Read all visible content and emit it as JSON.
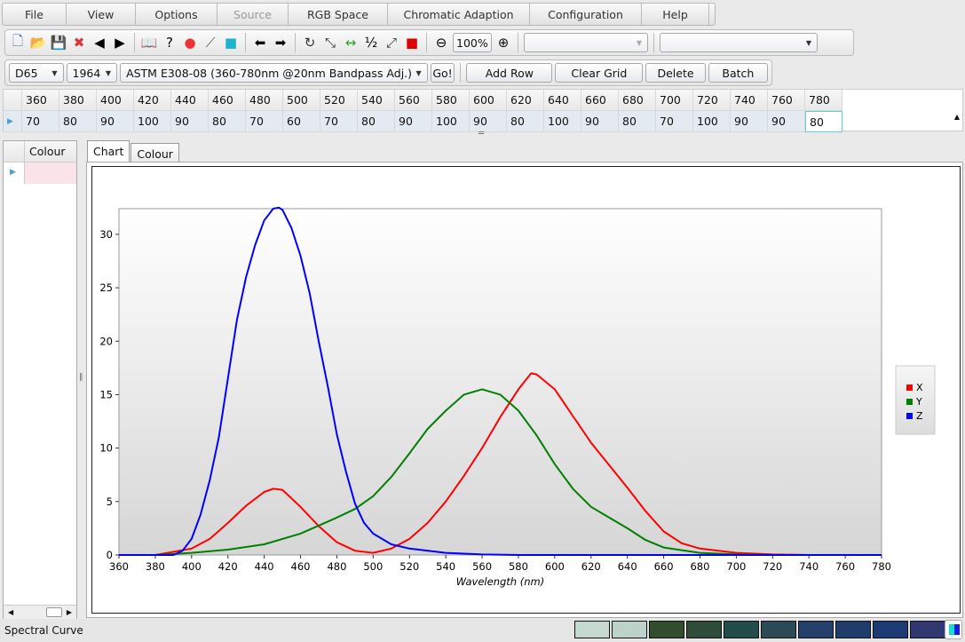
{
  "menu": [
    "File",
    "View",
    "Options",
    "Source",
    "RGB Space",
    "Chromatic Adaption",
    "Configuration",
    "Help"
  ],
  "toolbar": {
    "zoom": "100%",
    "icons": [
      "new-file-icon",
      "open-folder-icon",
      "save-icon",
      "close-file-icon",
      "import-icon",
      "export-icon",
      "book-icon",
      "help-icon",
      "color-wheel-icon",
      "chart-icon",
      "color-squares-icon",
      "back-arrow-icon",
      "forward-arrow-icon",
      "rotate-icon",
      "size-icon",
      "fit-width-icon",
      "half-icon",
      "fullscreen-icon",
      "color-blocks-icon"
    ]
  },
  "toolbar2": {
    "illuminant": "D65",
    "observer": "1964",
    "table": "ASTM E308-08 (360-780nm @20nm Bandpass Adj.)",
    "go": "Go!",
    "add_row": "Add Row",
    "clear_grid": "Clear Grid",
    "delete": "Delete",
    "batch": "Batch"
  },
  "grid": {
    "headers": [
      "360",
      "380",
      "400",
      "420",
      "440",
      "460",
      "480",
      "500",
      "520",
      "540",
      "560",
      "580",
      "600",
      "620",
      "640",
      "660",
      "680",
      "700",
      "720",
      "740",
      "760",
      "780"
    ],
    "values": [
      "70",
      "80",
      "90",
      "100",
      "90",
      "80",
      "70",
      "60",
      "70",
      "80",
      "90",
      "100",
      "90",
      "80",
      "100",
      "90",
      "80",
      "70",
      "100",
      "90",
      "90",
      "80"
    ]
  },
  "left_panel": {
    "header": "Colour"
  },
  "tabs": [
    "Chart",
    "Colour"
  ],
  "status": {
    "text": "Spectral Curve",
    "swatches": [
      "#c5d9d0",
      "#bdd3c9",
      "#344c2e",
      "#2f4c3a",
      "#234d4a",
      "#2c4a55",
      "#24406a",
      "#1f3d6b",
      "#1c3b72",
      "#313871"
    ]
  },
  "chart_data": {
    "type": "line",
    "xlabel": "Wavelength (nm)",
    "ylabel": "",
    "xlim": [
      360,
      780
    ],
    "ylim": [
      0,
      32.4
    ],
    "xticks": [
      360,
      380,
      400,
      420,
      440,
      460,
      480,
      500,
      520,
      540,
      560,
      580,
      600,
      620,
      640,
      660,
      680,
      700,
      720,
      740,
      760,
      780
    ],
    "yticks": [
      0,
      5,
      10,
      15,
      20,
      25,
      30
    ],
    "legend": "right",
    "grid": false,
    "series": [
      {
        "name": "X",
        "color": "#ff0000",
        "x": [
          360,
          380,
          400,
          410,
          420,
          430,
          440,
          445,
          450,
          460,
          470,
          480,
          490,
          500,
          510,
          520,
          530,
          540,
          550,
          560,
          570,
          580,
          587,
          590,
          600,
          610,
          620,
          630,
          640,
          650,
          660,
          670,
          680,
          700,
          720,
          740,
          780
        ],
        "y": [
          0,
          0,
          0.6,
          1.5,
          3,
          4.6,
          5.9,
          6.2,
          6.1,
          4.5,
          2.7,
          1.2,
          0.4,
          0.2,
          0.6,
          1.5,
          3,
          5,
          7.4,
          10,
          12.9,
          15.5,
          17,
          16.9,
          15.5,
          13,
          10.5,
          8.4,
          6.3,
          4.1,
          2.2,
          1.1,
          0.6,
          0.2,
          0.05,
          0,
          0
        ]
      },
      {
        "name": "Y",
        "color": "#008000",
        "x": [
          360,
          380,
          400,
          420,
          440,
          460,
          480,
          490,
          500,
          510,
          520,
          530,
          540,
          550,
          560,
          570,
          580,
          590,
          600,
          610,
          620,
          630,
          640,
          650,
          660,
          680,
          700,
          720,
          780
        ],
        "y": [
          0,
          0,
          0.2,
          0.5,
          1,
          2,
          3.5,
          4.3,
          5.5,
          7.3,
          9.5,
          11.8,
          13.5,
          15,
          15.5,
          15,
          13.5,
          11.2,
          8.5,
          6.2,
          4.5,
          3.5,
          2.5,
          1.4,
          0.7,
          0.2,
          0.05,
          0,
          0
        ]
      },
      {
        "name": "Z",
        "color": "#0000ff",
        "x": [
          360,
          380,
          390,
          395,
          400,
          405,
          410,
          415,
          420,
          425,
          430,
          435,
          440,
          445,
          448,
          450,
          455,
          460,
          465,
          470,
          475,
          480,
          485,
          490,
          495,
          500,
          510,
          520,
          540,
          560,
          580,
          780
        ],
        "y": [
          0,
          0,
          0,
          0.4,
          1.5,
          3.8,
          7,
          11,
          16.5,
          22,
          26,
          29,
          31.3,
          32.4,
          32.5,
          32.3,
          30.6,
          28,
          24.5,
          20,
          15.8,
          11.3,
          7.8,
          4.8,
          3,
          2,
          1,
          0.6,
          0.2,
          0.05,
          0,
          0
        ]
      }
    ]
  }
}
